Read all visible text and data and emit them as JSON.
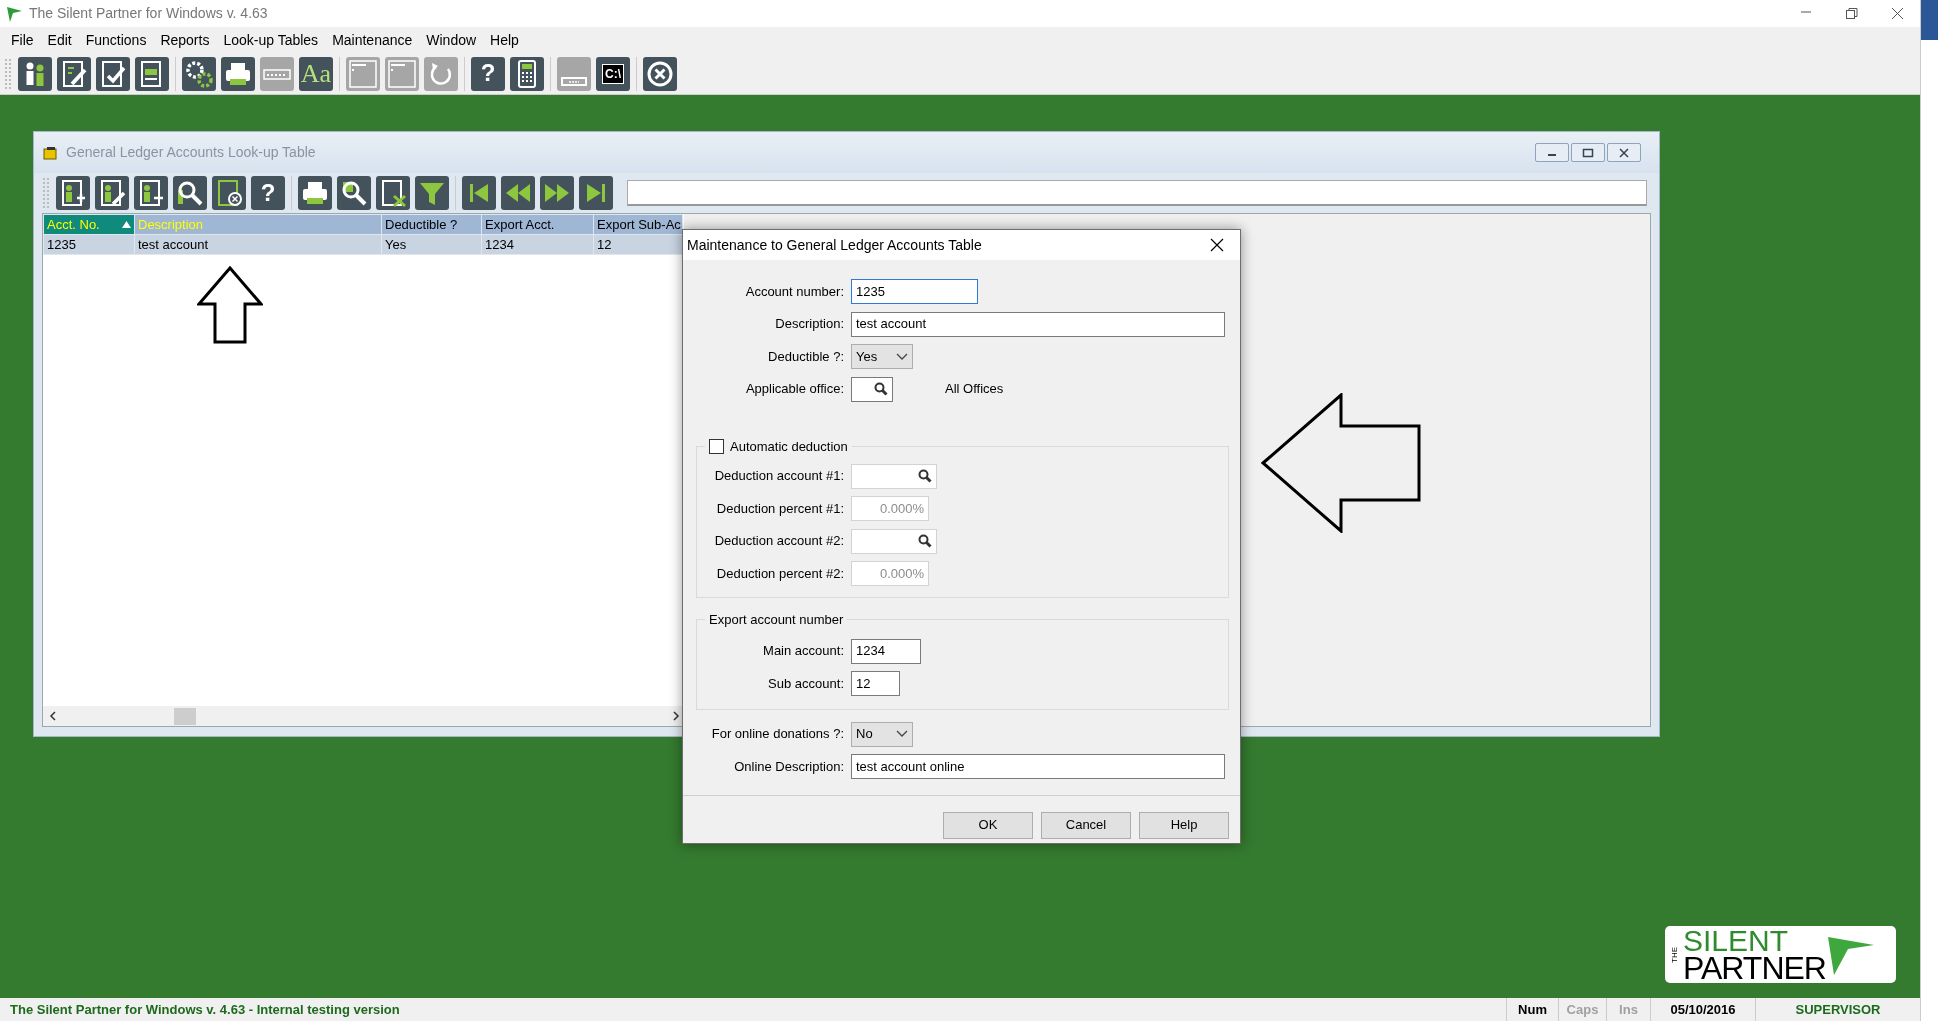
{
  "app": {
    "title": "The Silent Partner for Windows v. 4.63"
  },
  "menu": [
    {
      "label": "File"
    },
    {
      "label": "Edit"
    },
    {
      "label": "Functions"
    },
    {
      "label": "Reports"
    },
    {
      "label": "Look-up Tables"
    },
    {
      "label": "Maintenance"
    },
    {
      "label": "Window"
    },
    {
      "label": "Help"
    }
  ],
  "toolbar": {
    "groups": [
      {
        "buttons": [
          {
            "disabled": false
          },
          {
            "disabled": false
          },
          {
            "disabled": false
          },
          {
            "disabled": false
          }
        ]
      },
      {
        "buttons": [
          {
            "disabled": false
          },
          {
            "disabled": false
          },
          {
            "disabled": true
          },
          {
            "disabled": false,
            "label": "Aa"
          }
        ]
      },
      {
        "buttons": [
          {
            "disabled": true
          },
          {
            "disabled": true
          },
          {
            "disabled": true
          }
        ]
      },
      {
        "buttons": [
          {
            "disabled": false,
            "label": "?"
          },
          {
            "disabled": false
          }
        ]
      },
      {
        "buttons": [
          {
            "disabled": true
          },
          {
            "disabled": false,
            "label": "C:\\"
          }
        ]
      },
      {
        "buttons": [
          {
            "disabled": false
          }
        ]
      }
    ]
  },
  "lookup_window": {
    "title": "General Ledger Accounts Look-up Table",
    "toolbar": {
      "groups": [
        {
          "buttons": [
            {
              "disabled": false
            },
            {
              "disabled": false
            },
            {
              "disabled": false
            },
            {
              "disabled": false
            },
            {
              "disabled": false
            },
            {
              "disabled": false,
              "label": "?"
            }
          ]
        },
        {
          "buttons": [
            {
              "disabled": false
            },
            {
              "disabled": false
            },
            {
              "disabled": false
            },
            {
              "disabled": false
            }
          ]
        },
        {
          "buttons": [
            {
              "disabled": false
            },
            {
              "disabled": false
            },
            {
              "disabled": false
            },
            {
              "disabled": false
            }
          ]
        }
      ]
    },
    "table": {
      "columns": [
        {
          "label": "Acct. No.",
          "sorted": true,
          "key": true
        },
        {
          "label": "Description",
          "sorted": false,
          "key": true
        },
        {
          "label": "Deductible ?",
          "sorted": false,
          "key": false
        },
        {
          "label": "Export Acct.",
          "sorted": false,
          "key": false
        },
        {
          "label": "Export Sub-Ac",
          "sorted": false,
          "key": false
        }
      ],
      "rows": [
        {
          "selected": true,
          "cells": [
            "1235",
            "test account",
            "Yes",
            "1234",
            "12"
          ]
        }
      ]
    }
  },
  "dialog": {
    "title": "Maintenance to General Ledger Accounts Table",
    "top_fields": [
      {
        "kind": "text",
        "label": "Account number:",
        "value": "1235",
        "focused": true,
        "disabled": false
      },
      {
        "kind": "text",
        "label": "Description:",
        "value": "test account",
        "focused": false,
        "disabled": false
      },
      {
        "kind": "select",
        "label": "Deductible ?:",
        "value": "Yes",
        "focused": false,
        "disabled": false
      },
      {
        "kind": "lookup",
        "label": "Applicable office:",
        "note": "All Offices",
        "focused": false,
        "disabled": false
      }
    ],
    "deduction_group": {
      "label": "Automatic deduction",
      "checked": false,
      "fields": [
        {
          "kind": "lookup",
          "label": "Deduction account #1:",
          "disabled": true
        },
        {
          "kind": "percent",
          "label": "Deduction percent #1:",
          "value": "0.000%",
          "disabled": true
        },
        {
          "kind": "lookup",
          "label": "Deduction account #2:",
          "disabled": true
        },
        {
          "kind": "percent",
          "label": "Deduction percent #2:",
          "value": "0.000%",
          "disabled": true
        }
      ]
    },
    "export_group": {
      "title": "Export account number",
      "fields": [
        {
          "kind": "text",
          "label": "Main account:",
          "value": "1234",
          "focused": false,
          "disabled": false
        },
        {
          "kind": "text",
          "label": "Sub account:",
          "value": "12",
          "focused": false,
          "disabled": false
        }
      ]
    },
    "bottom_fields": [
      {
        "kind": "select",
        "label": "For online donations ?:",
        "value": "No",
        "focused": false,
        "disabled": false
      },
      {
        "kind": "text",
        "label": "Online Description:",
        "value": "test account online",
        "focused": false,
        "disabled": false
      }
    ],
    "buttons": [
      "OK",
      "Cancel",
      "Help"
    ]
  },
  "logo": {
    "the": "THE",
    "silent": "SILENT",
    "partner": "PARTNER"
  },
  "status_bar": {
    "message": "The Silent Partner for Windows v. 4.63 - Internal testing version",
    "indicators": [
      {
        "label": "Num",
        "on": true
      },
      {
        "label": "Caps",
        "on": false
      },
      {
        "label": "Ins",
        "on": false
      }
    ],
    "date": "05/10/2016",
    "user": "SUPERVISOR"
  }
}
